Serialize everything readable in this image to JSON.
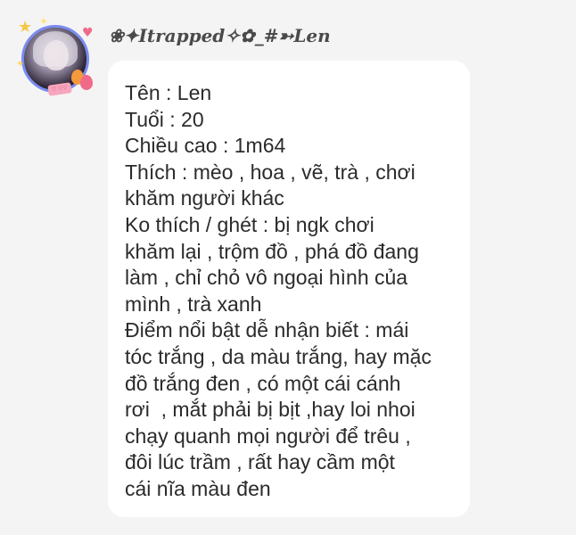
{
  "sender": {
    "name": "❀✦Itrapped✧✿_#➳Len"
  },
  "avatar": {
    "icon": "profile-avatar",
    "badge_text": "♡ ♡♡"
  },
  "message": {
    "lines": [
      "Tên : Len",
      "Tuổi : 20",
      "Chiều cao : 1m64",
      "Thích : mèo , hoa , vẽ, trà , chơi",
      "khăm người khác",
      "Ko thích / ghét : bị ngk chơi",
      "khăm lại , trộm đồ , phá đồ đang",
      "làm , chỉ chỏ vô ngoại hình của",
      "mình , trà xanh",
      "Điểm nổi bật dễ nhận biết : mái",
      "tóc trắng , da màu trắng, hay mặc",
      "đồ trắng đen , có một cái cánh",
      "rơi  , mắt phải bị bịt ,hay loi nhoi",
      "chạy quanh mọi người để trêu ,",
      "đôi lúc trầm , rất hay cầm một",
      "cái nĩa màu đen"
    ]
  },
  "colors": {
    "background": "#f4f4f4",
    "bubble": "#ffffff",
    "text": "#2b2b2b",
    "avatar_ring": "#7b8cf0"
  }
}
